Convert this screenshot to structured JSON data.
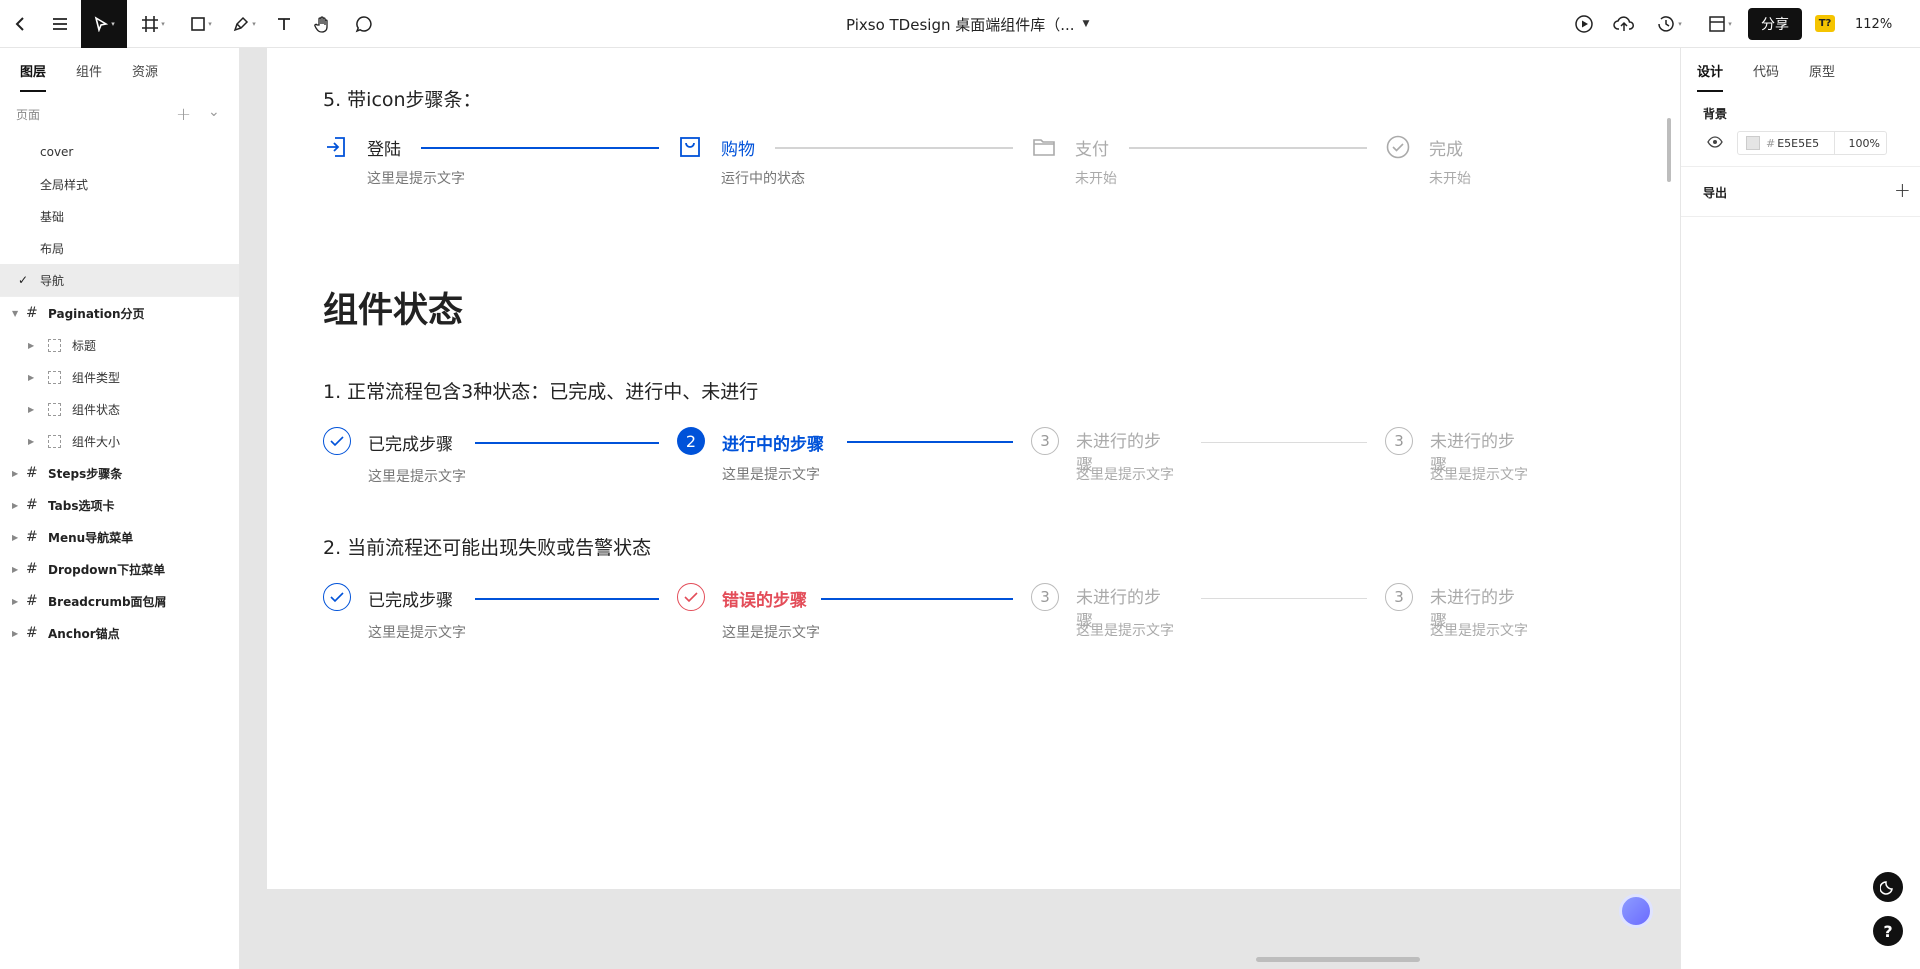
{
  "topbar": {
    "title": "Pixso TDesign 桌面端组件库（...",
    "share_label": "分享",
    "avatar_label": "T?",
    "zoom": "112%"
  },
  "left_panel": {
    "tabs": [
      "图层",
      "组件",
      "资源"
    ],
    "pages_label": "页面",
    "pages": [
      "cover",
      "全局样式",
      "基础",
      "布局",
      "导航"
    ],
    "layers": [
      {
        "label": "Pagination分页"
      },
      {
        "label": "标题"
      },
      {
        "label": "组件类型"
      },
      {
        "label": "组件状态"
      },
      {
        "label": "组件大小"
      },
      {
        "label": "Steps步骤条"
      },
      {
        "label": "Tabs选项卡"
      },
      {
        "label": "Menu导航菜单"
      },
      {
        "label": "Dropdown下拉菜单"
      },
      {
        "label": "Breadcrumb面包屑"
      },
      {
        "label": "Anchor锚点"
      }
    ]
  },
  "canvas": {
    "icon_steps": {
      "heading": "5. 带icon步骤条：",
      "steps": [
        {
          "title": "登陆",
          "desc": "这里是提示文字"
        },
        {
          "title": "购物",
          "desc": "运行中的状态"
        },
        {
          "title": "支付",
          "desc": "未开始"
        },
        {
          "title": "完成",
          "desc": "未开始"
        }
      ]
    },
    "state_title": "组件状态",
    "normal": {
      "heading": "1. 正常流程包含3种状态：已完成、进行中、未进行",
      "steps": [
        {
          "num": "",
          "title": "已完成步骤",
          "desc": "这里是提示文字"
        },
        {
          "num": "2",
          "title": "进行中的步骤",
          "desc": "这里是提示文字"
        },
        {
          "num": "3",
          "title": "未进行的步骤",
          "desc": "这里是提示文字"
        },
        {
          "num": "3",
          "title": "未进行的步骤",
          "desc": "这里是提示文字"
        }
      ]
    },
    "error": {
      "heading": "2. 当前流程还可能出现失败或告警状态",
      "steps": [
        {
          "num": "",
          "title": "已完成步骤",
          "desc": "这里是提示文字"
        },
        {
          "num": "",
          "title": "错误的步骤",
          "desc": "这里是提示文字"
        },
        {
          "num": "3",
          "title": "未进行的步骤",
          "desc": "这里是提示文字"
        },
        {
          "num": "3",
          "title": "未进行的步骤",
          "desc": "这里是提示文字"
        }
      ]
    }
  },
  "right_panel": {
    "tabs": [
      "设计",
      "代码",
      "原型"
    ],
    "background_label": "背景",
    "bg_color": "E5E5E5",
    "bg_opacity": "100%",
    "export_label": "导出"
  },
  "colors": {
    "primary": "#0052d9",
    "error": "#e34d59",
    "canvas_bg": "#e5e5e5"
  }
}
